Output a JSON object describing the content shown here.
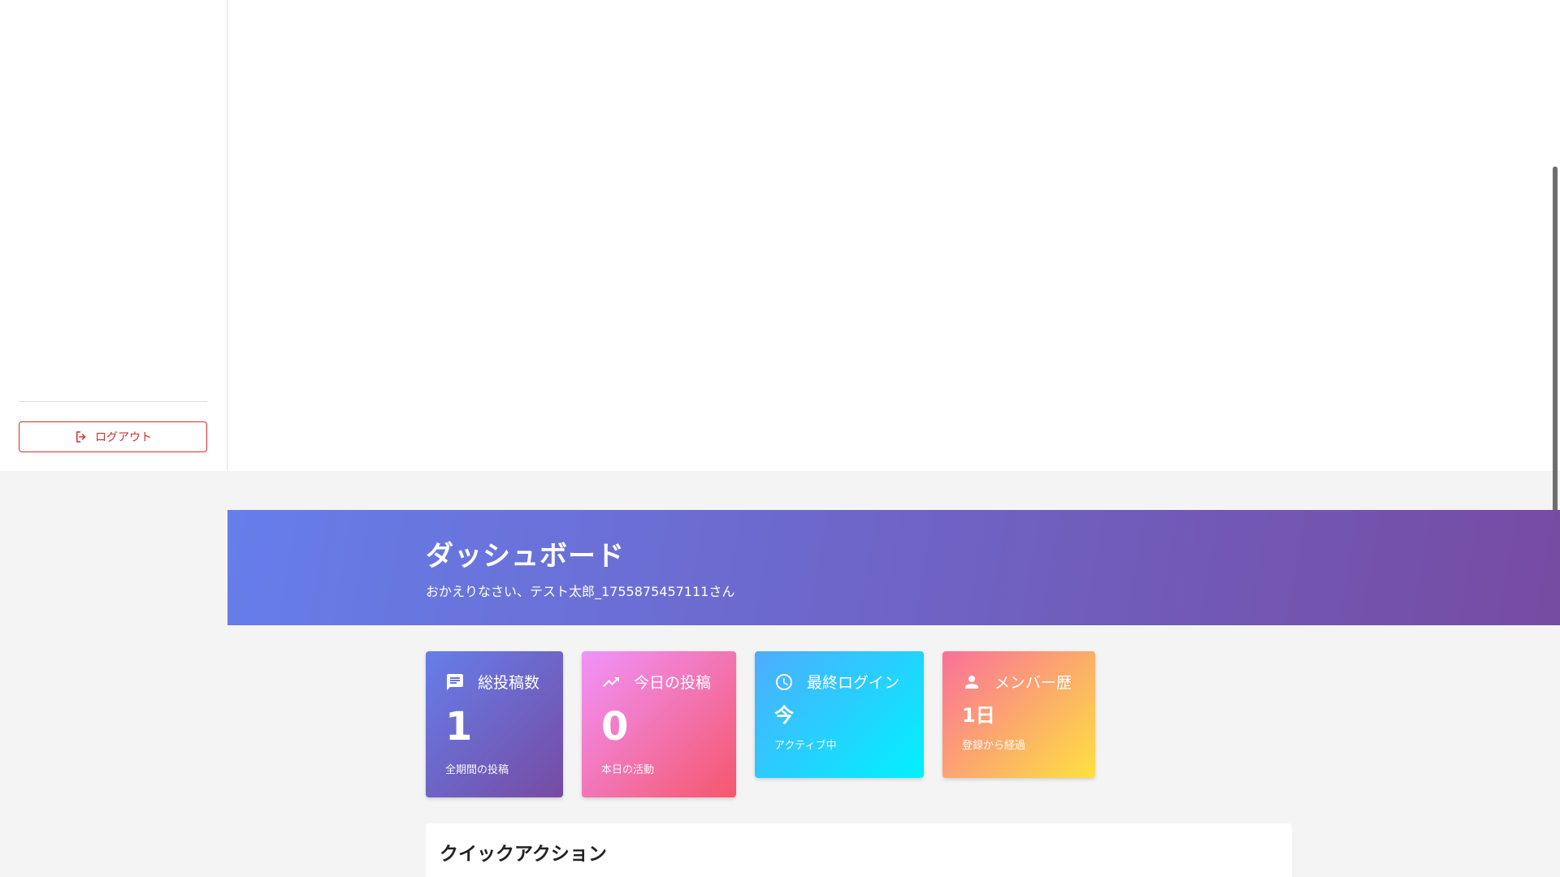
{
  "sidebar": {
    "logout_label": "ログアウト"
  },
  "hero": {
    "title": "ダッシュボード",
    "subtitle": "おかえりなさい、テスト太郎_1755875457111さん"
  },
  "stats": [
    {
      "title": "総投稿数",
      "icon": "chat-icon",
      "value": "1",
      "note": "全期間の投稿"
    },
    {
      "title": "今日の投稿",
      "icon": "trending-up-icon",
      "value": "0",
      "note": "本日の活動"
    },
    {
      "title": "最終ログイン",
      "icon": "clock-icon",
      "value": "今",
      "note": "アクティブ中"
    },
    {
      "title": "メンバー歴",
      "icon": "person-icon",
      "value": "1日",
      "note": "登録から経過"
    }
  ],
  "quick_actions": {
    "title": "クイックアクション"
  },
  "colors": {
    "logout": "#d32f2f",
    "hero_start": "#667eea",
    "hero_end": "#764ba2"
  }
}
